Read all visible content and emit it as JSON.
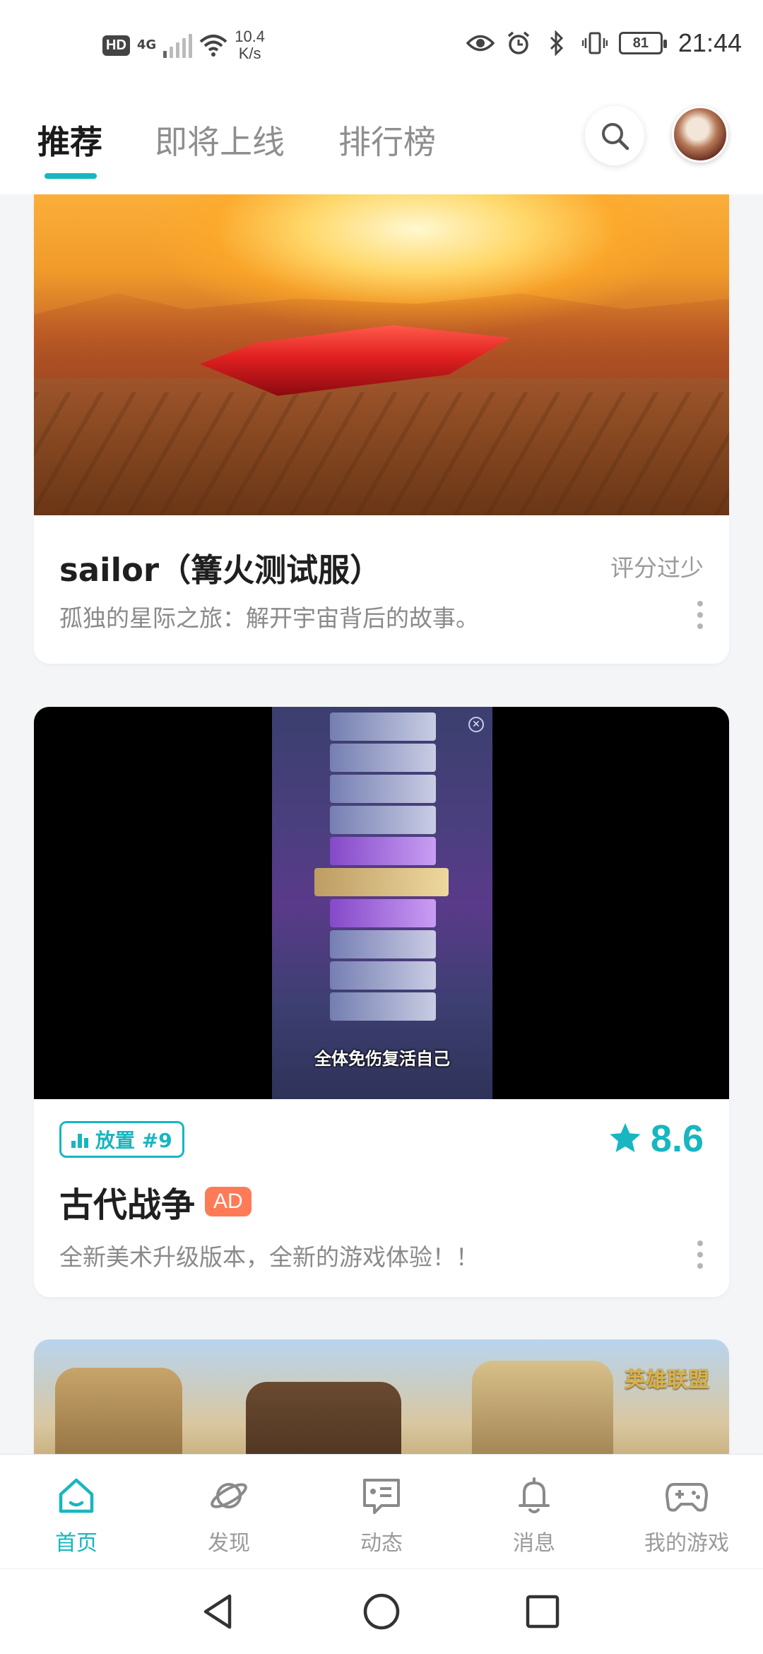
{
  "status_bar": {
    "hd": "HD",
    "network": "4G",
    "speed_value": "10.4",
    "speed_unit": "K/s",
    "battery": "81",
    "time": "21:44"
  },
  "top_tabs": [
    {
      "label": "推荐",
      "active": true
    },
    {
      "label": "即将上线",
      "active": false
    },
    {
      "label": "排行榜",
      "active": false
    }
  ],
  "cards": [
    {
      "title": "sailor（篝火测试服）",
      "score_text": "评分过少",
      "description": "孤独的星际之旅：解开宇宙背后的故事。"
    },
    {
      "video_caption": "全体免伤复活自己",
      "tag": "放置 #9",
      "rating": "8.6",
      "title": "古代战争",
      "badge": "AD",
      "description": "全新美术升级版本，全新的游戏体验！！"
    },
    {
      "logo_text": "英雄联盟"
    }
  ],
  "bottom_nav": [
    {
      "label": "首页",
      "icon": "home-icon",
      "active": true
    },
    {
      "label": "发现",
      "icon": "planet-icon",
      "active": false
    },
    {
      "label": "动态",
      "icon": "message-card-icon",
      "active": false
    },
    {
      "label": "消息",
      "icon": "bell-icon",
      "active": false
    },
    {
      "label": "我的游戏",
      "icon": "gamepad-icon",
      "active": false
    }
  ],
  "colors": {
    "accent": "#17b6c0",
    "ad_badge": "#ff7b57"
  }
}
